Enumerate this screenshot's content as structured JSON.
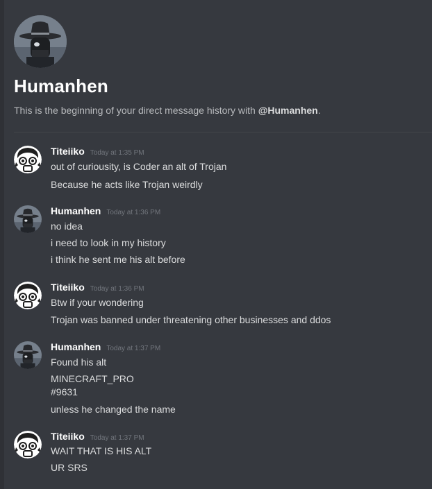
{
  "header": {
    "name": "Humanhen",
    "intro_prefix": "This is the beginning of your direct message history with ",
    "intro_mention": "@Humanhen",
    "intro_suffix": "."
  },
  "messages": [
    {
      "author": "Titeiiko",
      "timestamp": "Today at 1:35 PM",
      "lines": [
        "out of curiousity, is Coder an alt of Trojan",
        "Because he acts like Trojan weirdly"
      ]
    },
    {
      "author": "Humanhen",
      "timestamp": "Today at 1:36 PM",
      "lines": [
        "no idea",
        "i need to look in my history",
        "i think he sent me his alt before"
      ]
    },
    {
      "author": "Titeiiko",
      "timestamp": "Today at 1:36 PM",
      "lines": [
        "Btw if your wondering",
        "Trojan was banned under threatening other businesses and ddos"
      ]
    },
    {
      "author": "Humanhen",
      "timestamp": "Today at 1:37 PM",
      "lines": [
        "Found his alt",
        "MINECRAFT_PRO",
        "#9631",
        "unless he changed the name"
      ]
    },
    {
      "author": "Titeiiko",
      "timestamp": "Today at 1:37 PM",
      "lines": [
        "WAIT THAT IS HIS ALT",
        "UR SRS"
      ]
    }
  ]
}
